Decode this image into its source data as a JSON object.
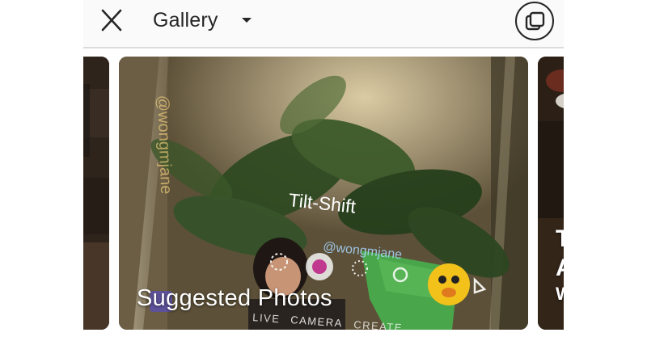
{
  "header": {
    "title": "Gallery",
    "close_icon": "close-icon",
    "dropdown_icon": "caret-down-icon",
    "multi_select_icon": "multi-select-icon"
  },
  "carousel": {
    "main_card": {
      "label": "Suggested Photos",
      "photo_text": {
        "effect_name": "Tilt-Shift",
        "watermark": "@wongmjane",
        "mode_live": "LIVE",
        "mode_camera": "CAMERA",
        "mode_create": "CREATE"
      }
    },
    "right_card": {
      "label_line1": "T",
      "label_line2": "A",
      "label_line3": "W"
    }
  },
  "colors": {
    "topbar_bg": "#fafafa",
    "icon": "#262626",
    "label": "#ffffff"
  }
}
